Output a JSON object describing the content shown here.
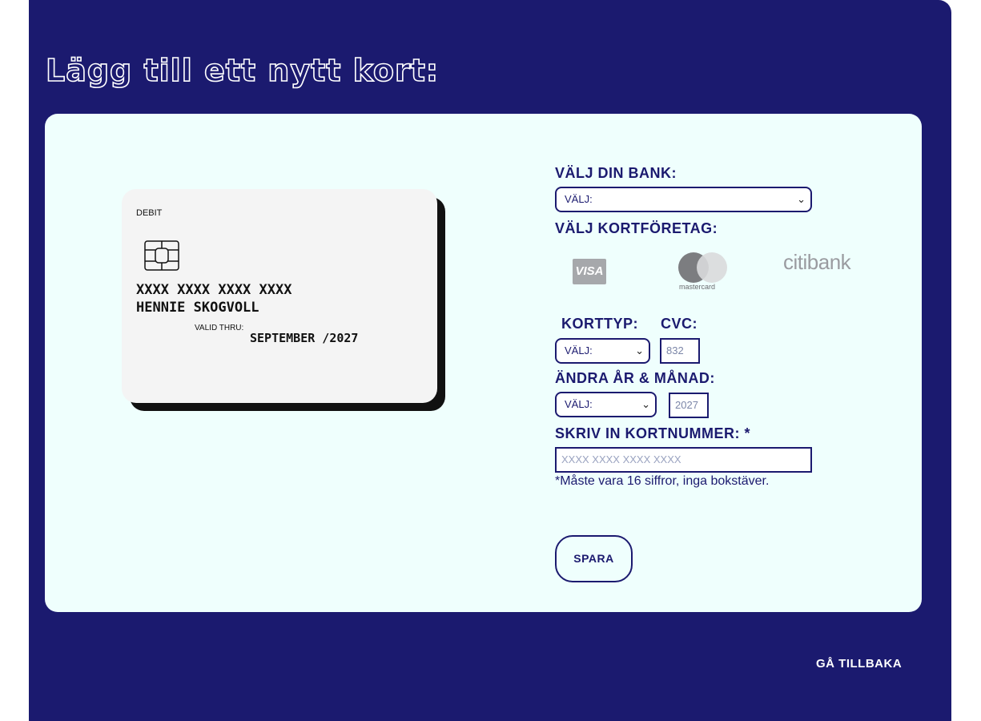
{
  "page": {
    "title": "Lägg till ett nytt kort:",
    "back_label": "GÅ TILLBAKA"
  },
  "card": {
    "type": "DEBIT",
    "number": "XXXX XXXX XXXX XXXX",
    "holder": "HENNIE SKOGVOLL",
    "valid_label": "VALID THRU:",
    "valid_value": "SEPTEMBER /2027"
  },
  "form": {
    "bank_label": "VÄLJ DIN BANK:",
    "bank_select": "VÄLJ:",
    "company_label": "VÄLJ KORTFÖRETAG:",
    "companies": {
      "visa": "VISA",
      "mastercard": "mastercard",
      "citibank": "citibank"
    },
    "card_type_label": "KORTTYP:",
    "card_type_select": "VÄLJ:",
    "cvc_label": "CVC:",
    "cvc_placeholder": "832",
    "expiry_label": "ÄNDRA ÅR & MÅNAD:",
    "expiry_select": "VÄLJ:",
    "year_placeholder": "2027",
    "number_label": "SKRIV IN KORTNUMMER: *",
    "number_placeholder": "XXXX XXXX XXXX XXXX",
    "hint": "*Måste vara 16 siffror, inga bokstäver.",
    "save_label": "SPARA"
  },
  "colors": {
    "background": "#1b1a6f",
    "panel": "#effffd",
    "card": "#f4f4f4"
  }
}
